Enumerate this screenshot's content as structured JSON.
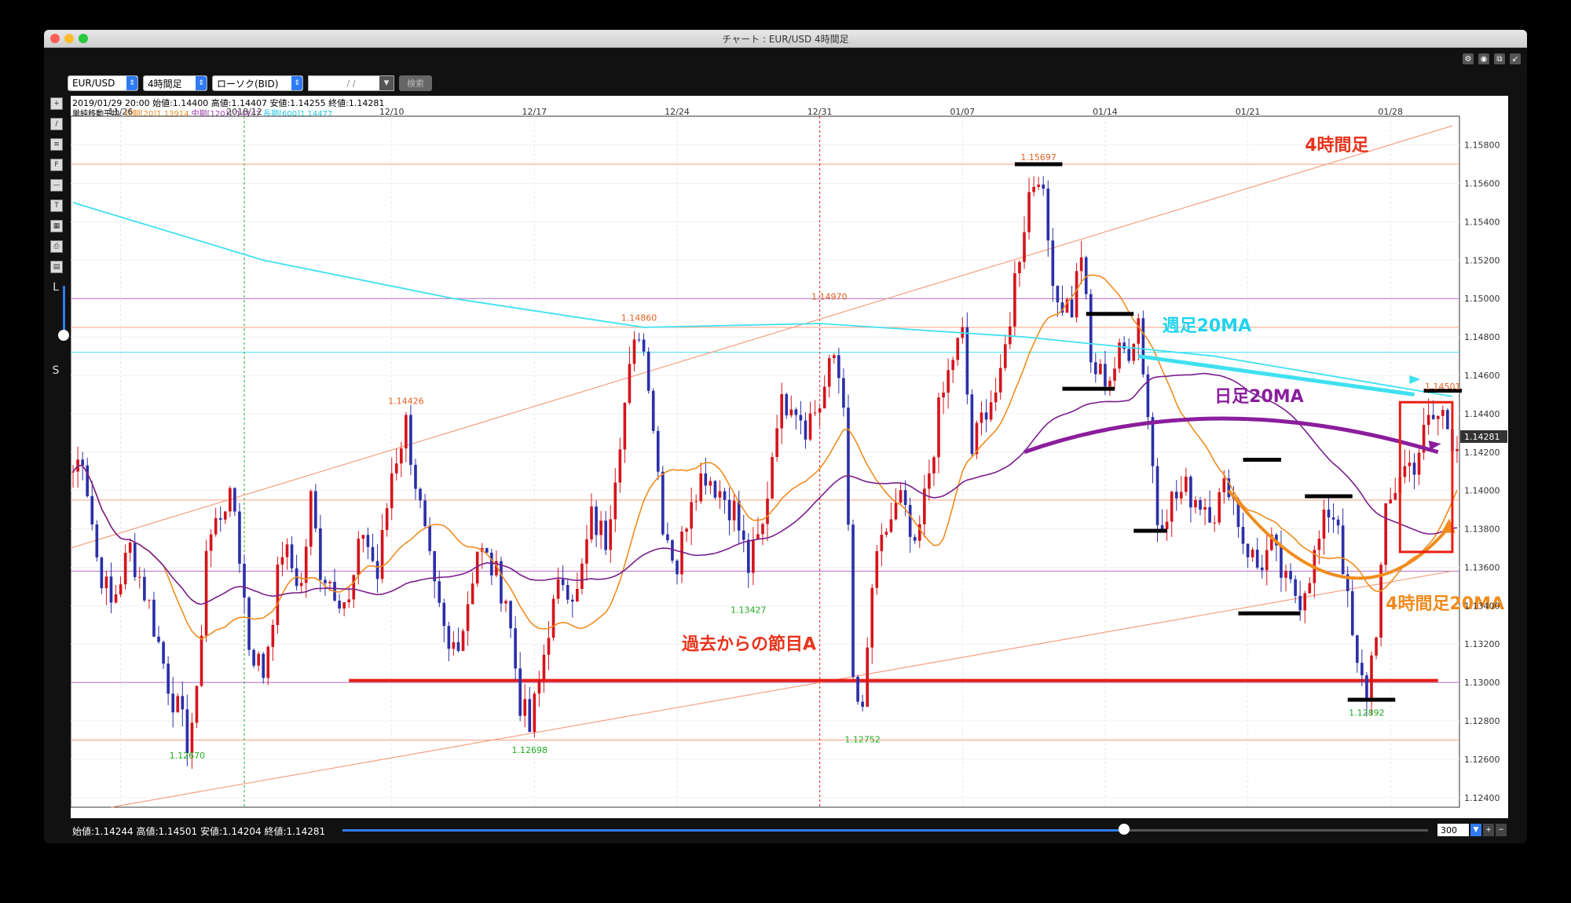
{
  "window": {
    "title": "チャート : EUR/USD 4時間足"
  },
  "toolbar": {
    "symbol": "EUR/USD",
    "timeframe": "4時間足",
    "chart_type": "ローソク(BID)",
    "date_placeholder": "/ /",
    "search_label": "検索"
  },
  "lefttools": {
    "l_label": "L",
    "s_label": "S"
  },
  "header": {
    "ohlc_line": "2019/01/29 20:00 始値:1.14400 高値:1.14407 安値:1.14255 終値:1.14281",
    "ma_prefix": "単純移動平均:",
    "ma_short": "短期[20]1.13914",
    "ma_mid": "中期[120]1.14147",
    "ma_long": "長期[600]1.14477"
  },
  "footer": {
    "ohlc_line": "始値:1.14244 高値:1.14501 安値:1.14204 終値:1.14281",
    "bar_count": "300"
  },
  "chart_data": {
    "type": "candlestick",
    "ylim": [
      1.1235,
      1.1595
    ],
    "y_ticks": [
      "1.12400",
      "1.12600",
      "1.12800",
      "1.13000",
      "1.13200",
      "1.13400",
      "1.13600",
      "1.13800",
      "1.14000",
      "1.14200",
      "1.14400",
      "1.14600",
      "1.14800",
      "1.15000",
      "1.15200",
      "1.15400",
      "1.15600",
      "1.15800"
    ],
    "x_labels": [
      {
        "label": "11/26",
        "i": 10
      },
      {
        "label": "2018/12",
        "i": 36
      },
      {
        "label": "12/10",
        "i": 67
      },
      {
        "label": "12/17",
        "i": 97
      },
      {
        "label": "12/24",
        "i": 127
      },
      {
        "label": "12/31",
        "i": 157
      },
      {
        "label": "01/07",
        "i": 187
      },
      {
        "label": "01/14",
        "i": 217
      },
      {
        "label": "01/21",
        "i": 247
      },
      {
        "label": "01/28",
        "i": 277
      }
    ],
    "n_slots": 292,
    "current_price": "1.14281",
    "colors": {
      "up": "#d4141c",
      "down": "#2b2fa8",
      "ma_short": "#f08c1e",
      "ma_mid": "#7a1f8c",
      "ma_long": "#3fe0f0"
    },
    "vertical_markers": [
      {
        "i": 36,
        "color": "#22aa22"
      },
      {
        "i": 157,
        "color": "#dd2222"
      }
    ],
    "horizontal_lines": [
      {
        "y": 1.157,
        "color": "#f4a080"
      },
      {
        "y": 1.15,
        "color": "#b070c0"
      },
      {
        "y": 1.1485,
        "color": "#f4a080"
      },
      {
        "y": 1.1472,
        "color": "#40e0f0"
      },
      {
        "y": 1.1395,
        "color": "#f4a080"
      },
      {
        "y": 1.1358,
        "color": "#b070c0"
      },
      {
        "y": 1.13,
        "color": "#b070c0"
      },
      {
        "y": 1.127,
        "color": "#f4a080"
      }
    ],
    "anchors": [
      [
        0,
        1.141
      ],
      [
        2,
        1.142
      ],
      [
        5,
        1.1365
      ],
      [
        8,
        1.134
      ],
      [
        12,
        1.137
      ],
      [
        16,
        1.134
      ],
      [
        20,
        1.13
      ],
      [
        24,
        1.127
      ],
      [
        26,
        1.129
      ],
      [
        28,
        1.137
      ],
      [
        32,
        1.1395
      ],
      [
        34,
        1.139
      ],
      [
        37,
        1.132
      ],
      [
        40,
        1.1305
      ],
      [
        44,
        1.137
      ],
      [
        48,
        1.135
      ],
      [
        50,
        1.1395
      ],
      [
        52,
        1.136
      ],
      [
        55,
        1.135
      ],
      [
        58,
        1.134
      ],
      [
        61,
        1.138
      ],
      [
        64,
        1.1355
      ],
      [
        67,
        1.141
      ],
      [
        70,
        1.1435
      ],
      [
        73,
        1.139
      ],
      [
        76,
        1.1345
      ],
      [
        79,
        1.1315
      ],
      [
        82,
        1.133
      ],
      [
        85,
        1.137
      ],
      [
        88,
        1.136
      ],
      [
        91,
        1.1345
      ],
      [
        94,
        1.129
      ],
      [
        96,
        1.1275
      ],
      [
        98,
        1.13
      ],
      [
        100,
        1.133
      ],
      [
        103,
        1.1355
      ],
      [
        106,
        1.1345
      ],
      [
        109,
        1.1385
      ],
      [
        112,
        1.1375
      ],
      [
        115,
        1.143
      ],
      [
        117,
        1.146
      ],
      [
        119,
        1.1485
      ],
      [
        121,
        1.146
      ],
      [
        124,
        1.1385
      ],
      [
        127,
        1.136
      ],
      [
        130,
        1.14
      ],
      [
        133,
        1.141
      ],
      [
        136,
        1.14
      ],
      [
        139,
        1.139
      ],
      [
        142,
        1.136
      ],
      [
        145,
        1.138
      ],
      [
        148,
        1.144
      ],
      [
        151,
        1.145
      ],
      [
        154,
        1.1435
      ],
      [
        157,
        1.1445
      ],
      [
        160,
        1.147
      ],
      [
        162,
        1.145
      ],
      [
        164,
        1.13
      ],
      [
        166,
        1.128
      ],
      [
        168,
        1.135
      ],
      [
        171,
        1.138
      ],
      [
        174,
        1.1395
      ],
      [
        177,
        1.1365
      ],
      [
        179,
        1.1395
      ],
      [
        182,
        1.144
      ],
      [
        185,
        1.147
      ],
      [
        187,
        1.148
      ],
      [
        189,
        1.142
      ],
      [
        192,
        1.1445
      ],
      [
        195,
        1.1455
      ],
      [
        198,
        1.151
      ],
      [
        201,
        1.1555
      ],
      [
        203,
        1.1568
      ],
      [
        205,
        1.153
      ],
      [
        207,
        1.15
      ],
      [
        210,
        1.1495
      ],
      [
        212,
        1.1525
      ],
      [
        214,
        1.1465
      ],
      [
        216,
        1.146
      ],
      [
        218,
        1.146
      ],
      [
        220,
        1.147
      ],
      [
        222,
        1.1475
      ],
      [
        224,
        1.149
      ],
      [
        226,
        1.144
      ],
      [
        228,
        1.1385
      ],
      [
        231,
        1.1395
      ],
      [
        234,
        1.14
      ],
      [
        237,
        1.1395
      ],
      [
        240,
        1.139
      ],
      [
        243,
        1.1405
      ],
      [
        246,
        1.1375
      ],
      [
        249,
        1.136
      ],
      [
        252,
        1.137
      ],
      [
        255,
        1.135
      ],
      [
        258,
        1.1345
      ],
      [
        261,
        1.1365
      ],
      [
        264,
        1.139
      ],
      [
        266,
        1.1385
      ],
      [
        268,
        1.134
      ],
      [
        270,
        1.1305
      ],
      [
        272,
        1.1295
      ],
      [
        274,
        1.133
      ],
      [
        276,
        1.1385
      ],
      [
        279,
        1.141
      ],
      [
        282,
        1.1415
      ],
      [
        285,
        1.1435
      ],
      [
        288,
        1.144
      ],
      [
        290,
        1.1428
      ]
    ],
    "ma_long_points": [
      [
        0,
        1.155
      ],
      [
        40,
        1.152
      ],
      [
        80,
        1.15
      ],
      [
        120,
        1.1485
      ],
      [
        157,
        1.1487
      ],
      [
        200,
        1.148
      ],
      [
        240,
        1.147
      ],
      [
        290,
        1.1449
      ]
    ],
    "peak_labels": [
      {
        "text": "1.15697",
        "i": 203,
        "y": 1.15697,
        "color": "#e06020",
        "pos": "above"
      },
      {
        "text": "1.14860",
        "i": 119,
        "y": 1.1486,
        "color": "#e06020",
        "pos": "above"
      },
      {
        "text": "1.14970",
        "i": 159,
        "y": 1.1497,
        "color": "#e06020",
        "pos": "above"
      },
      {
        "text": "1.14426",
        "i": 70,
        "y": 1.14426,
        "color": "#e06020",
        "pos": "above"
      },
      {
        "text": "1.13427",
        "i": 142,
        "y": 1.13427,
        "color": "#22aa22",
        "pos": "below"
      },
      {
        "text": "1.12670",
        "i": 24,
        "y": 1.1267,
        "color": "#22aa22",
        "pos": "below"
      },
      {
        "text": "1.12698",
        "i": 96,
        "y": 1.12698,
        "color": "#22aa22",
        "pos": "below"
      },
      {
        "text": "1.12752",
        "i": 166,
        "y": 1.12752,
        "color": "#22aa22",
        "pos": "below"
      },
      {
        "text": "1.12892",
        "i": 272,
        "y": 1.12892,
        "color": "#22aa22",
        "pos": "below"
      },
      {
        "text": "1.14501",
        "i": 288,
        "y": 1.14501,
        "color": "#e06020",
        "pos": "above"
      }
    ],
    "annotations": {
      "title_4h": "4時間足",
      "weekly_ma": "週足20MA",
      "daily_ma": "日足20MA",
      "h4_ma": "4時間足20MA",
      "support_a": "過去からの節目A"
    },
    "black_levels": [
      {
        "i0": 198,
        "i1": 208,
        "y": 1.157
      },
      {
        "i0": 213,
        "i1": 223,
        "y": 1.1492
      },
      {
        "i0": 208,
        "i1": 219,
        "y": 1.1453
      },
      {
        "i0": 246,
        "i1": 254,
        "y": 1.1416
      },
      {
        "i0": 223,
        "i1": 230,
        "y": 1.1379
      },
      {
        "i0": 259,
        "i1": 269,
        "y": 1.1397
      },
      {
        "i0": 245,
        "i1": 258,
        "y": 1.1336
      },
      {
        "i0": 268,
        "i1": 278,
        "y": 1.1291
      },
      {
        "i0": 284,
        "i1": 292,
        "y": 1.1452
      }
    ]
  }
}
